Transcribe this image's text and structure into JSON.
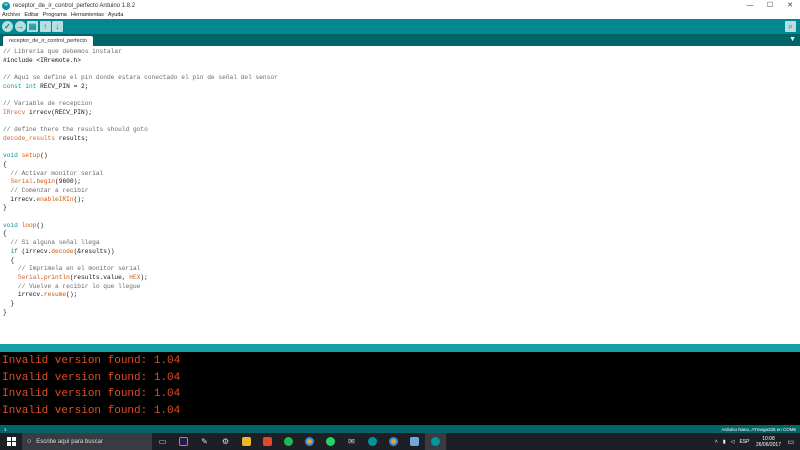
{
  "window": {
    "title": "receptor_de_ir_control_perfecto Arduino 1.8.2",
    "min": "—",
    "max": "☐",
    "close": "✕"
  },
  "menu": [
    "Archivo",
    "Editar",
    "Programa",
    "Herramientas",
    "Ayuda"
  ],
  "toolbar": {
    "verify": "✓",
    "upload": "→",
    "new": "▤",
    "open": "↑",
    "save": "↓",
    "serial": "⌕"
  },
  "tab": {
    "label": "receptor_de_ir_control_perfecto",
    "menu": "▼"
  },
  "code": [
    "// Libreria que debemos instalar",
    "#include <IRremote.h>",
    "",
    "// Aqui se define el pin donde estara conectado el pin de señal del sensor",
    "const int RECV_PIN = 2;",
    "",
    "// Variable de recepcion",
    "IRrecv irrecv(RECV_PIN);",
    "",
    "// define there the results should goto",
    "decode_results results;",
    "",
    "void setup()",
    "{",
    "  // Activar monitor serial",
    "  Serial.begin(9600);",
    "  // Comenzar a recibir",
    "  irrecv.enableIRIn();",
    "}",
    "",
    "void loop()",
    "{",
    "  // Si alguna señal llega",
    "  if (irrecv.decode(&results))",
    "  {",
    "    // Imprimela en el monitor serial",
    "    Serial.println(results.value, HEX);",
    "    // Vuelve a recibir lo que llegue",
    "    irrecv.resume();",
    "  }",
    "}"
  ],
  "console": [
    "Invalid version found: 1.04",
    "Invalid version found: 1.04",
    "Invalid version found: 1.04",
    "Invalid version found: 1.04"
  ],
  "status": {
    "line": "1",
    "board": "Arduino Nano, ATmega328 en COM5"
  },
  "taskbar": {
    "search_placeholder": "Escribe aquí para buscar",
    "lang": "ESP",
    "time": "10:08",
    "date": "26/06/2017"
  },
  "colors": {
    "toolbar": "#00878f",
    "tabbar": "#006468",
    "console_text": "#e34c22",
    "keyword": "#00979c"
  }
}
